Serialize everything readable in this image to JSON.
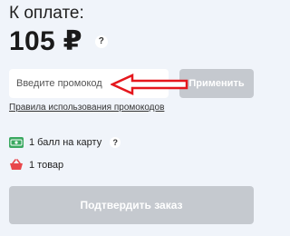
{
  "summary": {
    "to_pay_label": "К оплате:",
    "total": "105 ₽",
    "help_mark": "?"
  },
  "promo": {
    "placeholder": "Введите промокод",
    "apply_label": "Применить",
    "rules_link": "Правила использования промокодов"
  },
  "points": {
    "text": "1 балл на карту",
    "help_mark": "?",
    "icon": "bonus-card-icon"
  },
  "items": {
    "text": "1 товар",
    "icon": "basket-icon"
  },
  "confirm": {
    "label": "Подтвердить заказ"
  },
  "colors": {
    "background": "#f0f4fa",
    "disabled_button": "#c5c9cf",
    "arrow": "#e5171d",
    "points_icon": "#3aa860",
    "basket_icon": "#e8474b"
  }
}
